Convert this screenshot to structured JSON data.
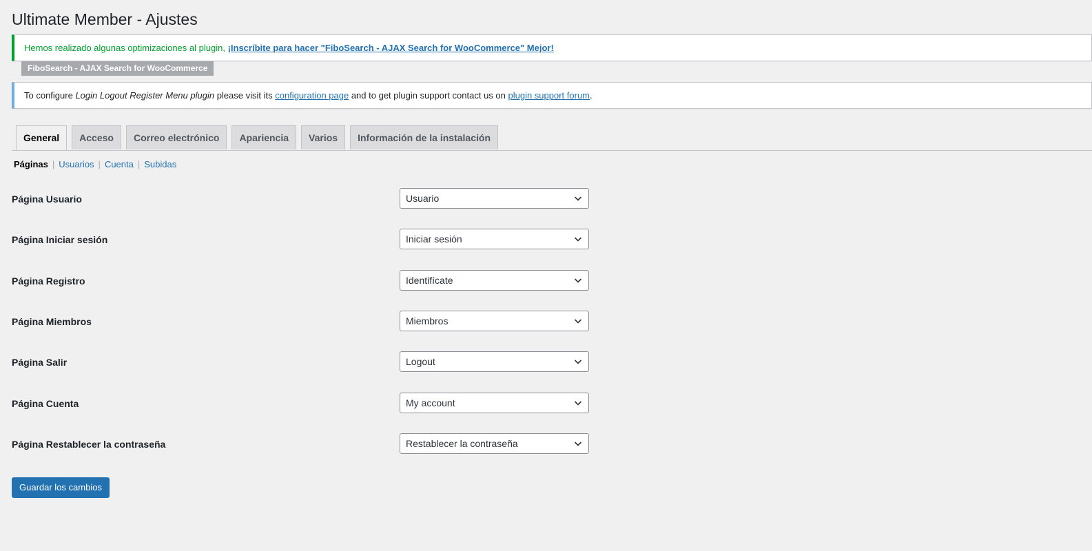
{
  "page": {
    "title": "Ultimate Member - Ajustes"
  },
  "notices": {
    "success": {
      "text": "Hemos realizado algunas optimizaciones al plugin, ",
      "link": "¡Inscríbite para hacer \"FiboSearch - AJAX Search for WooCommerce\" Mejor!",
      "tag": "FiboSearch - AJAX Search for WooCommerce"
    },
    "info": {
      "text_1": "To configure ",
      "plugin_name": "Login Logout Register Menu plugin",
      "text_2": " please visit its ",
      "link_1": "configuration page",
      "text_3": " and to get plugin support contact us on ",
      "link_2": "plugin support forum",
      "text_4": "."
    }
  },
  "tabs": [
    {
      "label": "General",
      "active": true
    },
    {
      "label": "Acceso"
    },
    {
      "label": "Correo electrónico"
    },
    {
      "label": "Apariencia"
    },
    {
      "label": "Varios"
    },
    {
      "label": "Información de la instalación"
    }
  ],
  "subnav": [
    {
      "label": "Páginas",
      "current": true
    },
    {
      "label": "Usuarios"
    },
    {
      "label": "Cuenta"
    },
    {
      "label": "Subidas"
    }
  ],
  "fields": [
    {
      "label": "Página Usuario",
      "value": "Usuario"
    },
    {
      "label": "Página Iniciar sesión",
      "value": "Iniciar sesión"
    },
    {
      "label": "Página Registro",
      "value": "Identifícate"
    },
    {
      "label": "Página Miembros",
      "value": "Miembros"
    },
    {
      "label": "Página Salir",
      "value": "Logout"
    },
    {
      "label": "Página Cuenta",
      "value": "My account"
    },
    {
      "label": "Página Restablecer la contraseña",
      "value": "Restablecer la contraseña"
    }
  ],
  "actions": {
    "save_label": "Guardar los cambios"
  },
  "colors": {
    "accent": "#2271b1",
    "success": "#00a32a",
    "info": "#72aee6",
    "background": "#f0f0f1"
  }
}
